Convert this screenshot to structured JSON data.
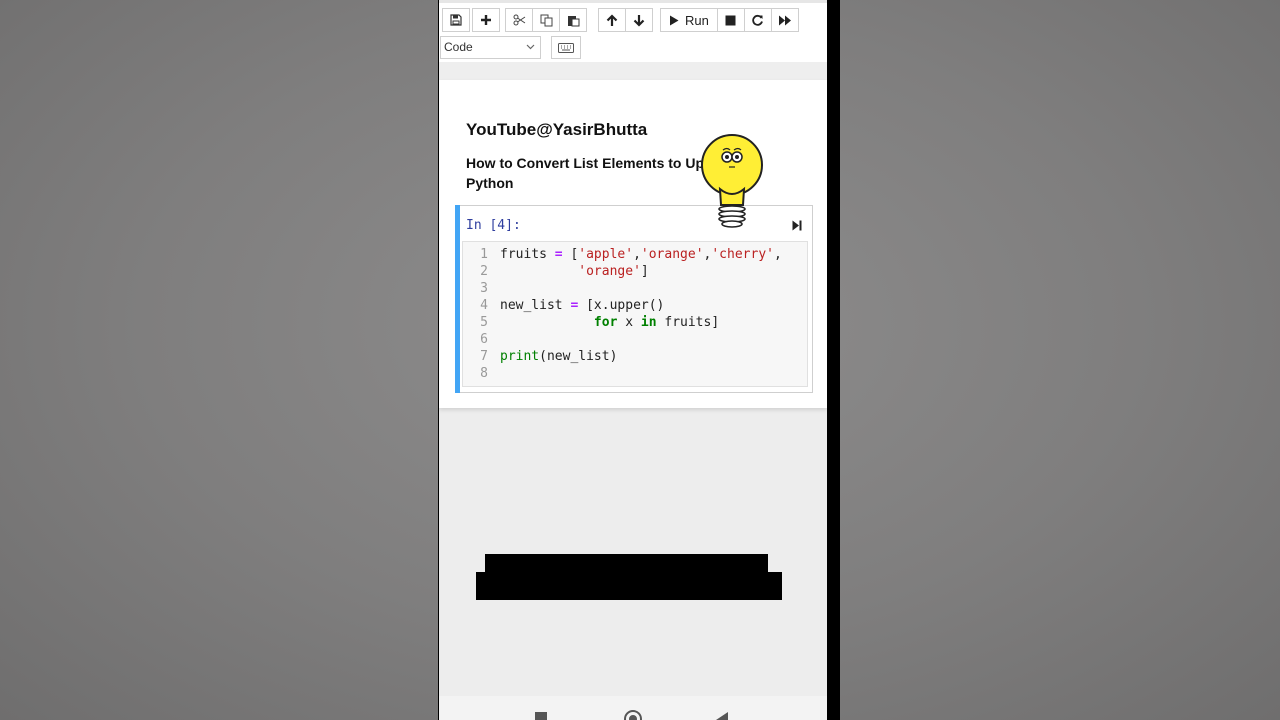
{
  "toolbar": {
    "buttons": [
      "save-icon",
      "add-icon",
      "cut-icon",
      "copy-icon",
      "paste-icon",
      "move-up-icon",
      "move-down-icon",
      "run-icon",
      "stop-icon",
      "restart-icon",
      "fast-forward-icon"
    ],
    "run_label": "Run",
    "cell_type": "Code",
    "keyboard_icon": "keyboard-icon"
  },
  "notebook": {
    "title": "YouTube@YasirBhutta",
    "subtitle": "How to Convert List Elements to Uppe",
    "subtitle_line2": "Python",
    "cell": {
      "prompt": "In [4]:",
      "line_numbers": [
        "1",
        "2",
        "3",
        "4",
        "5",
        "6",
        "7",
        "8"
      ]
    }
  },
  "colors": {
    "cell_accent": "#42a5f5",
    "keyword": "#008000",
    "operator": "#aa22ff",
    "string": "#ba2121",
    "prompt": "#303f9f"
  }
}
